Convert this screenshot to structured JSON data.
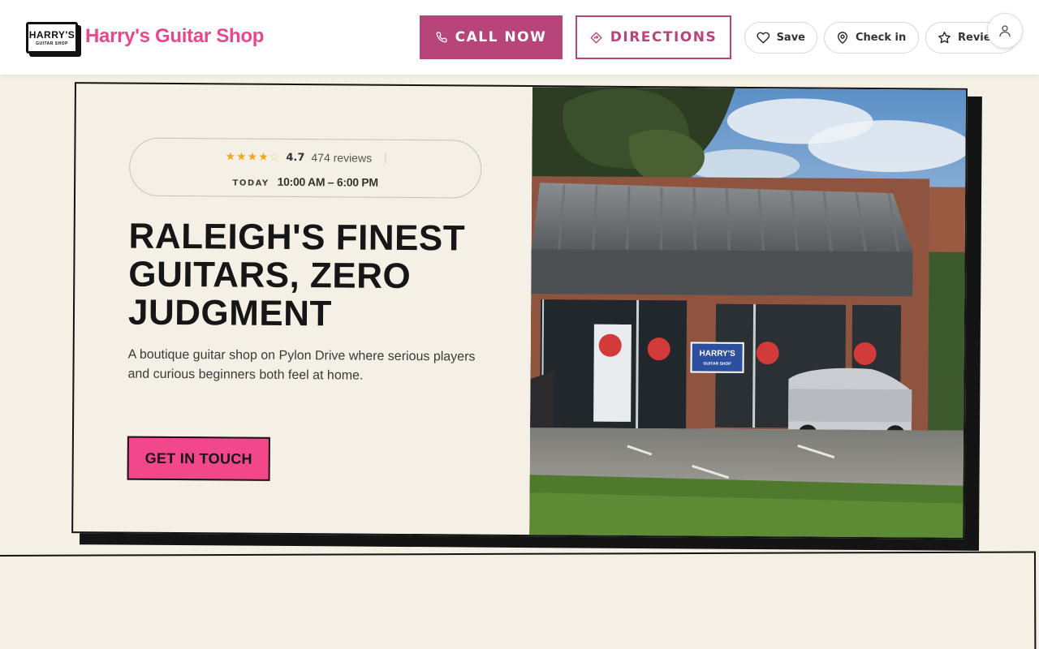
{
  "header": {
    "logo_line1": "HARRY'S",
    "logo_line2": "GUITAR SHOP",
    "brand_name": "Harry's Guitar Shop",
    "call_label": "CALL NOW",
    "directions_label": "DIRECTIONS",
    "save_label": "Save",
    "checkin_label": "Check in",
    "review_label": "Review"
  },
  "hero": {
    "rating_value": "4.7",
    "rating_count": "474 reviews",
    "stars_filled": 4.5,
    "today_label": "TODAY",
    "today_hours": "10:00 AM – 6:00 PM",
    "headline": "RALEIGH'S FINEST GUITARS, ZERO JUDGMENT",
    "subtext": "A boutique guitar shop on Pylon Drive where serious players and curious beginners both feel at home.",
    "cta_label": "GET IN TOUCH"
  },
  "photo": {
    "sign_line1": "HARRY'S",
    "sign_line2": "GUITAR SHOP"
  },
  "colors": {
    "brand_pink": "#e8488b",
    "button_magenta": "#b8457a",
    "cta_pink": "#f2478b",
    "star_gold": "#f2a71b",
    "background_cream": "#f5f0e6",
    "ink": "#141414"
  },
  "icons": {
    "call": "phone-icon",
    "directions": "directions-icon",
    "save": "heart-icon",
    "checkin": "map-pin-icon",
    "review": "star-outline-icon",
    "account": "user-icon"
  }
}
